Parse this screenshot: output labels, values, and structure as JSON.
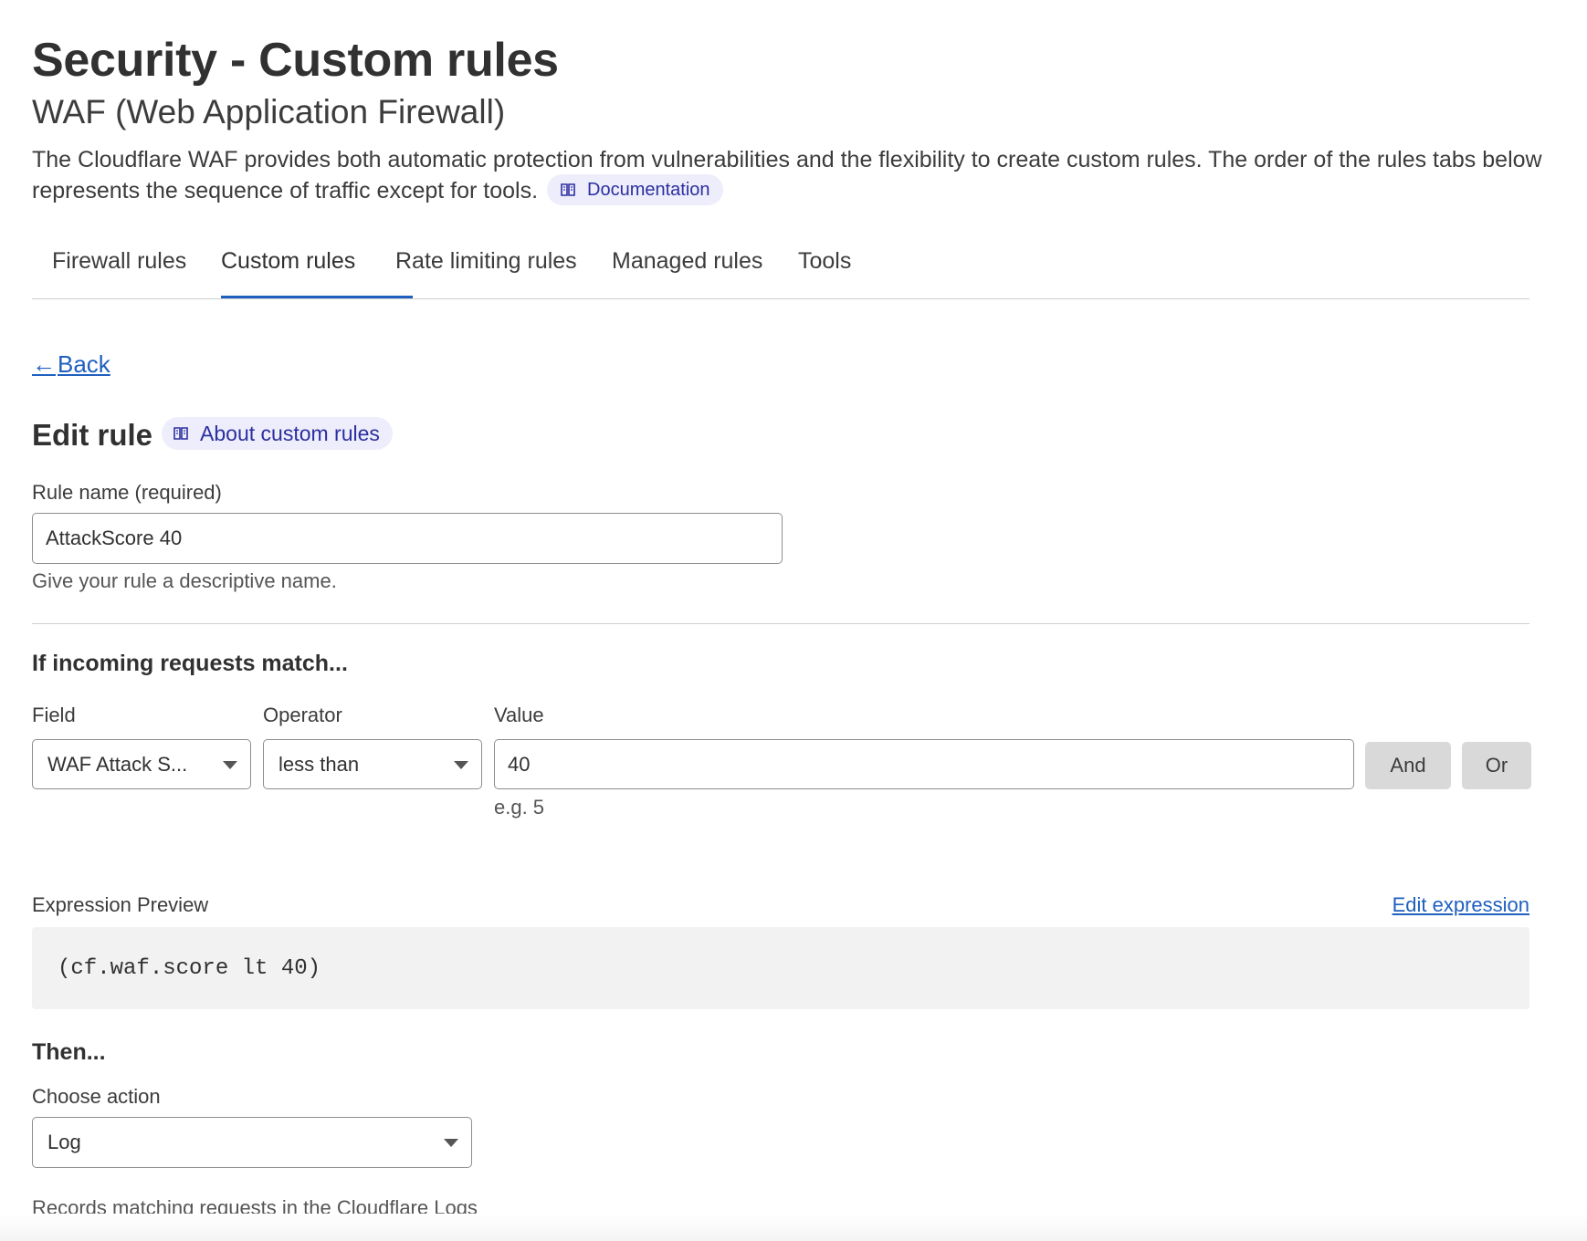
{
  "header": {
    "title": "Security - Custom rules",
    "subtitle": "WAF (Web Application Firewall)",
    "description": "The Cloudflare WAF provides both automatic protection from vulnerabilities and the flexibility to create custom rules. The order of the rules tabs below represents the sequence of traffic except for tools.",
    "doc_link": "Documentation",
    "doc_icon": "book-icon"
  },
  "tabs": [
    {
      "label": "Firewall rules",
      "active": false
    },
    {
      "label": "Custom rules",
      "active": true
    },
    {
      "label": "Rate limiting rules",
      "active": false
    },
    {
      "label": "Managed rules",
      "active": false
    },
    {
      "label": "Tools",
      "active": false
    }
  ],
  "back": {
    "label": "Back",
    "icon": "arrow-left-icon"
  },
  "edit": {
    "heading": "Edit rule",
    "about_link": "About custom rules",
    "rule_name_label": "Rule name (required)",
    "rule_name_value": "AttackScore 40",
    "rule_name_hint": "Give your rule a descriptive name."
  },
  "match": {
    "heading": "If incoming requests match...",
    "field_label": "Field",
    "field_value": "WAF Attack S...",
    "operator_label": "Operator",
    "operator_value": "less than",
    "value_label": "Value",
    "value_value": "40",
    "value_hint": "e.g. 5",
    "and_label": "And",
    "or_label": "Or"
  },
  "expression": {
    "label": "Expression Preview",
    "edit_link": "Edit expression",
    "code": "(cf.waf.score lt 40)"
  },
  "then": {
    "heading": "Then...",
    "action_label": "Choose action",
    "action_value": "Log",
    "action_hint": "Records matching requests in the Cloudflare Logs"
  },
  "colors": {
    "accent": "#1f5fbf",
    "pill_bg": "#eeedfb",
    "pill_text": "#2b2fa0"
  }
}
